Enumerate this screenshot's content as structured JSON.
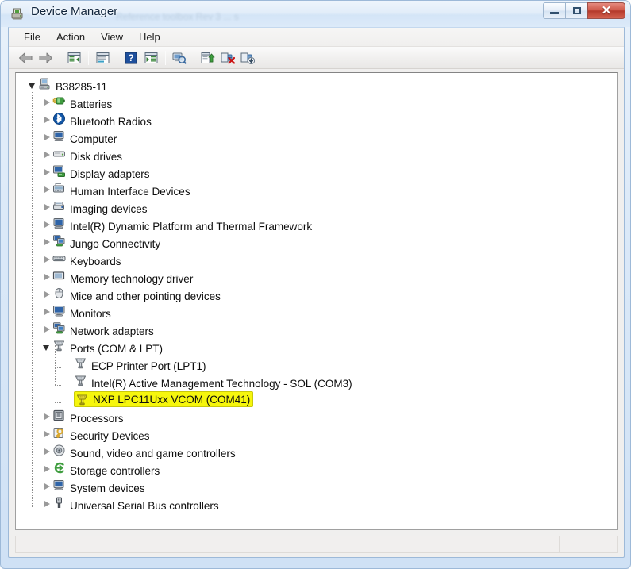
{
  "window": {
    "title": "Device Manager",
    "title_icon": "device-manager-icon",
    "ghost_text": "Reference toolbox Rev 3 ... s",
    "buttons": {
      "minimize": "Minimize",
      "maximize": "Maximize",
      "close": "Close"
    }
  },
  "menubar": {
    "items": [
      {
        "label": "File",
        "name": "menu-file"
      },
      {
        "label": "Action",
        "name": "menu-action"
      },
      {
        "label": "View",
        "name": "menu-view"
      },
      {
        "label": "Help",
        "name": "menu-help"
      }
    ]
  },
  "toolbar": {
    "buttons": [
      {
        "name": "back-button",
        "icon": "back-arrow-icon",
        "tooltip": "Back"
      },
      {
        "name": "forward-button",
        "icon": "forward-arrow-icon",
        "tooltip": "Forward"
      },
      {
        "name": "show-hide-console-tree-button",
        "icon": "console-tree-icon",
        "tooltip": "Show/Hide Console Tree"
      },
      {
        "name": "properties-button",
        "icon": "properties-icon",
        "tooltip": "Properties"
      },
      {
        "name": "help-button",
        "icon": "help-question-icon",
        "tooltip": "Help"
      },
      {
        "name": "show-hide-action-pane-button",
        "icon": "action-pane-icon",
        "tooltip": "Show/Hide Action Pane"
      },
      {
        "name": "scan-for-hardware-changes-button",
        "icon": "scan-hardware-icon",
        "tooltip": "Scan for hardware changes"
      },
      {
        "name": "update-driver-button",
        "icon": "update-driver-icon",
        "tooltip": "Update Driver Software"
      },
      {
        "name": "uninstall-device-button",
        "icon": "uninstall-device-icon",
        "tooltip": "Uninstall"
      },
      {
        "name": "disable-device-button",
        "icon": "disable-device-icon",
        "tooltip": "Disable"
      }
    ]
  },
  "tree": {
    "root": {
      "label": "B38285-11",
      "icon": "computer-root-icon",
      "expanded": true
    },
    "nodes": [
      {
        "label": "Batteries",
        "icon": "battery-icon",
        "expanded": false,
        "level": 1
      },
      {
        "label": "Bluetooth Radios",
        "icon": "bluetooth-icon",
        "expanded": false,
        "level": 1
      },
      {
        "label": "Computer",
        "icon": "computer-icon",
        "expanded": false,
        "level": 1
      },
      {
        "label": "Disk drives",
        "icon": "disk-drive-icon",
        "expanded": false,
        "level": 1
      },
      {
        "label": "Display adapters",
        "icon": "display-adapter-icon",
        "expanded": false,
        "level": 1
      },
      {
        "label": "Human Interface Devices",
        "icon": "hid-icon",
        "expanded": false,
        "level": 1
      },
      {
        "label": "Imaging devices",
        "icon": "imaging-device-icon",
        "expanded": false,
        "level": 1
      },
      {
        "label": "Intel(R) Dynamic Platform and Thermal Framework",
        "icon": "computer-icon",
        "expanded": false,
        "level": 1
      },
      {
        "label": "Jungo Connectivity",
        "icon": "network-adapter-icon",
        "expanded": false,
        "level": 1
      },
      {
        "label": "Keyboards",
        "icon": "keyboard-icon",
        "expanded": false,
        "level": 1
      },
      {
        "label": "Memory technology driver",
        "icon": "memory-icon",
        "expanded": false,
        "level": 1
      },
      {
        "label": "Mice and other pointing devices",
        "icon": "mouse-icon",
        "expanded": false,
        "level": 1
      },
      {
        "label": "Monitors",
        "icon": "monitor-icon",
        "expanded": false,
        "level": 1
      },
      {
        "label": "Network adapters",
        "icon": "network-adapter-icon",
        "expanded": false,
        "level": 1
      },
      {
        "label": "Ports (COM & LPT)",
        "icon": "port-icon",
        "expanded": true,
        "level": 1
      },
      {
        "label": "ECP Printer Port (LPT1)",
        "icon": "port-icon",
        "expanded": null,
        "level": 2
      },
      {
        "label": "Intel(R) Active Management Technology - SOL (COM3)",
        "icon": "port-icon",
        "expanded": null,
        "level": 2
      },
      {
        "label": "NXP LPC11Uxx  VCOM (COM41)",
        "icon": "port-icon-yellow",
        "expanded": null,
        "level": 2,
        "highlighted": true
      },
      {
        "label": "Processors",
        "icon": "processor-icon",
        "expanded": false,
        "level": 1
      },
      {
        "label": "Security Devices",
        "icon": "security-key-icon",
        "expanded": false,
        "level": 1
      },
      {
        "label": "Sound, video and game controllers",
        "icon": "sound-icon",
        "expanded": false,
        "level": 1
      },
      {
        "label": "Storage controllers",
        "icon": "storage-controller-icon",
        "expanded": false,
        "level": 1
      },
      {
        "label": "System devices",
        "icon": "computer-icon",
        "expanded": false,
        "level": 1
      },
      {
        "label": "Universal Serial Bus controllers",
        "icon": "usb-icon",
        "expanded": false,
        "level": 1
      }
    ]
  },
  "statusbar": {
    "panes": [
      {
        "name": "status-pane-main",
        "text": ""
      },
      {
        "name": "status-pane-second",
        "text": ""
      },
      {
        "name": "status-pane-third",
        "text": ""
      }
    ]
  },
  "colors": {
    "highlight": "#f6f60d",
    "title_text": "#11253c",
    "tree_text": "#0d0d0d",
    "close_button": "#b4392b"
  }
}
